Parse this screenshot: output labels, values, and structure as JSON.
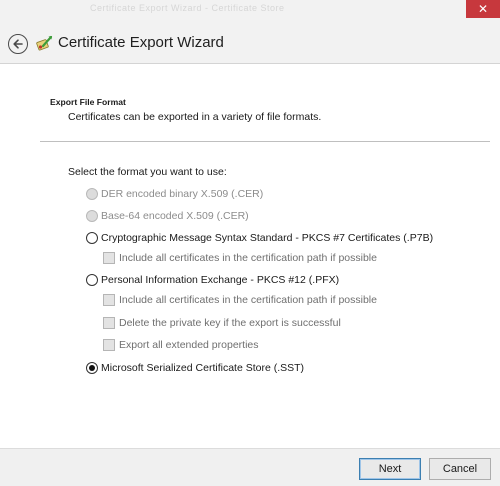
{
  "window": {
    "background_text": "Certificate Export Wizard - Certificate Store",
    "close_glyph": "✕",
    "title": "Certificate Export Wizard",
    "back_icon": "back-arrow-icon",
    "wizard_icon": "certificate-wizard-icon"
  },
  "header": {
    "heading": "Export File Format",
    "description": "Certificates can be exported in a variety of file formats."
  },
  "body": {
    "prompt": "Select the format you want to use:",
    "options": [
      {
        "label": "DER encoded binary X.509 (.CER)",
        "enabled": false,
        "selected": false
      },
      {
        "label": "Base-64 encoded X.509 (.CER)",
        "enabled": false,
        "selected": false
      },
      {
        "label": "Cryptographic Message Syntax Standard - PKCS #7 Certificates (.P7B)",
        "enabled": true,
        "selected": false
      },
      {
        "label": "Personal Information Exchange - PKCS #12 (.PFX)",
        "enabled": true,
        "selected": false
      },
      {
        "label": "Microsoft Serialized Certificate Store (.SST)",
        "enabled": true,
        "selected": true
      }
    ],
    "p7b_options": [
      {
        "label": "Include all certificates in the certification path if possible",
        "checked": false,
        "enabled": false
      }
    ],
    "pfx_options": [
      {
        "label": "Include all certificates in the certification path if possible",
        "checked": false,
        "enabled": false
      },
      {
        "label": "Delete the private key if the export is successful",
        "checked": false,
        "enabled": false
      },
      {
        "label": "Export all extended properties",
        "checked": false,
        "enabled": false
      }
    ]
  },
  "footer": {
    "next_label": "Next",
    "cancel_label": "Cancel"
  },
  "colors": {
    "title_bar": "#f2f2f2",
    "close_button": "#c7383d",
    "footer": "#f0f0f0",
    "focus_border": "#3c7fb1"
  }
}
